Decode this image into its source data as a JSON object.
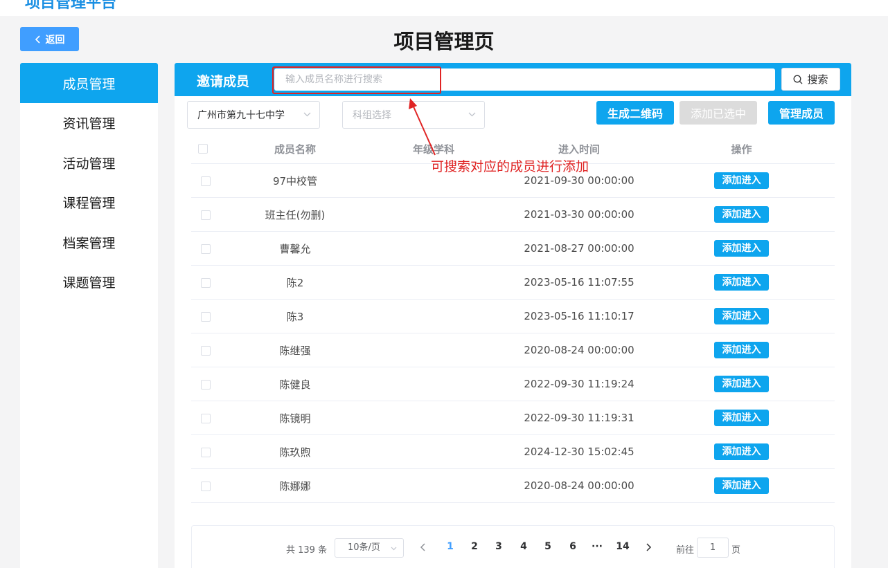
{
  "app": {
    "brand": "项目管理平台",
    "page_title": "项目管理页"
  },
  "back_button": {
    "label": "返回"
  },
  "sidebar": {
    "items": [
      {
        "label": "成员管理",
        "active": true
      },
      {
        "label": "资讯管理",
        "active": false
      },
      {
        "label": "活动管理",
        "active": false
      },
      {
        "label": "课程管理",
        "active": false
      },
      {
        "label": "档案管理",
        "active": false
      },
      {
        "label": "课题管理",
        "active": false
      }
    ]
  },
  "invite": {
    "title": "邀请成员",
    "search_placeholder": "输入成员名称进行搜索",
    "search_value": "",
    "search_button": "搜索"
  },
  "annotation": {
    "text": "可搜索对应的成员进行添加",
    "color": "#e02424"
  },
  "filters": {
    "school": "广州市第九十七中学",
    "subject_placeholder": "科组选择"
  },
  "actions": {
    "qr": "生成二维码",
    "add_selected": "添加已选中",
    "manage": "管理成员"
  },
  "table": {
    "headers": {
      "name": "成员名称",
      "grade": "年级学科",
      "time": "进入时间",
      "op": "操作"
    },
    "op_label": "添加进入",
    "rows": [
      {
        "name": "97中校管",
        "grade": "",
        "time": "2021-09-30 00:00:00"
      },
      {
        "name": "班主任(勿删)",
        "grade": "",
        "time": "2021-03-30 00:00:00"
      },
      {
        "name": "曹馨允",
        "grade": "",
        "time": "2021-08-27 00:00:00"
      },
      {
        "name": "陈2",
        "grade": "",
        "time": "2023-05-16 11:07:55"
      },
      {
        "name": "陈3",
        "grade": "",
        "time": "2023-05-16 11:10:17"
      },
      {
        "name": "陈继强",
        "grade": "",
        "time": "2020-08-24 00:00:00"
      },
      {
        "name": "陈健良",
        "grade": "",
        "time": "2022-09-30 11:19:24"
      },
      {
        "name": "陈镜明",
        "grade": "",
        "time": "2022-09-30 11:19:31"
      },
      {
        "name": "陈玖煦",
        "grade": "",
        "time": "2024-12-30 15:02:45"
      },
      {
        "name": "陈娜娜",
        "grade": "",
        "time": "2020-08-24 00:00:00"
      }
    ]
  },
  "pagination": {
    "total": "共 139 条",
    "page_size": "10条/页",
    "pages": [
      "1",
      "2",
      "3",
      "4",
      "5",
      "6",
      "···",
      "14"
    ],
    "current": "1",
    "goto_label": "前往",
    "goto_value": "1",
    "goto_unit": "页"
  },
  "colors": {
    "primary": "#0ea5ee",
    "back_button": "#409eff",
    "disabled": "#dcdcdc"
  }
}
